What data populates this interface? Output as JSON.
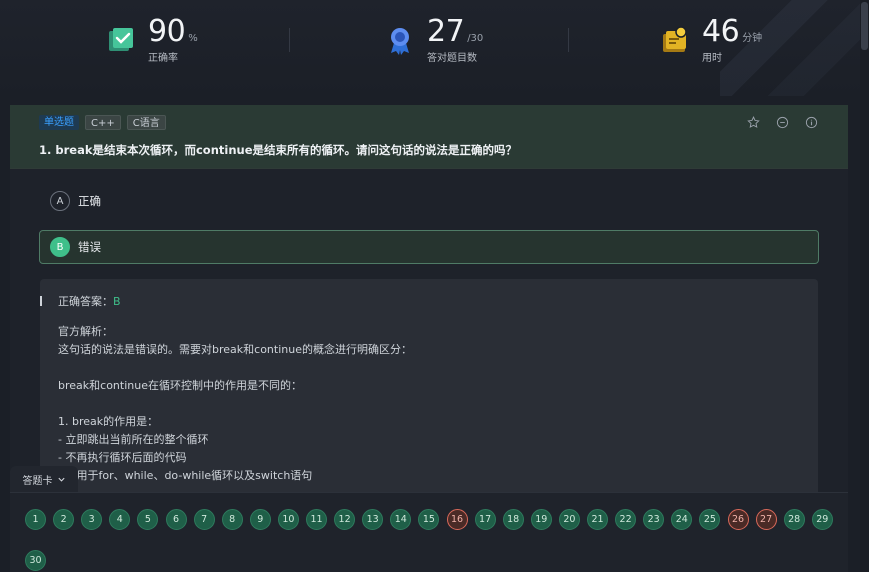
{
  "stats": [
    {
      "value": "90",
      "unit": "%",
      "label": "正确率",
      "icon": "check-board-icon"
    },
    {
      "value": "27",
      "unit": "/30",
      "label": "答对题目数",
      "icon": "medal-icon"
    },
    {
      "value": "46",
      "unit": "分钟",
      "label": "用时",
      "icon": "timer-board-icon"
    }
  ],
  "question": {
    "type_tag": "单选题",
    "tags": [
      "C++",
      "C语言"
    ],
    "title": "1. break是结束本次循环，而continue是结束所有的循环。请问这句话的说法是正确的吗？",
    "tools": [
      "star-icon",
      "minus-circle-icon",
      "info-icon"
    ]
  },
  "options": [
    {
      "letter": "A",
      "text": "正确",
      "selected": false
    },
    {
      "letter": "B",
      "text": "错误",
      "selected": true
    }
  ],
  "analysis": {
    "answer_label": "正确答案：",
    "answer_value": "B",
    "heading": "官方解析：",
    "intro": "这句话的说法是错误的。需要对break和continue的概念进行明确区分：",
    "line2": "break和continue在循环控制中的作用是不同的：",
    "point1": "1. break的作用是：",
    "bullet1": "- 立即跳出当前所在的整个循环",
    "bullet2": "- 不再执行循环后面的代码",
    "bullet3": "- 适用于for、while、do-while循环以及switch语句"
  },
  "sheet": {
    "tab_label": "答题卡",
    "numbers": [
      "1",
      "2",
      "3",
      "4",
      "5",
      "6",
      "7",
      "8",
      "9",
      "10",
      "11",
      "12",
      "13",
      "14",
      "15",
      "16",
      "17",
      "18",
      "19",
      "20",
      "21",
      "22",
      "23",
      "24",
      "25",
      "26",
      "27",
      "28",
      "29",
      "30"
    ],
    "wrong": [
      "16",
      "26",
      "27"
    ]
  },
  "colors": {
    "accent": "#3fbf8a",
    "wrong": "#d9695a",
    "tag_blue": "#3aa0ff"
  }
}
